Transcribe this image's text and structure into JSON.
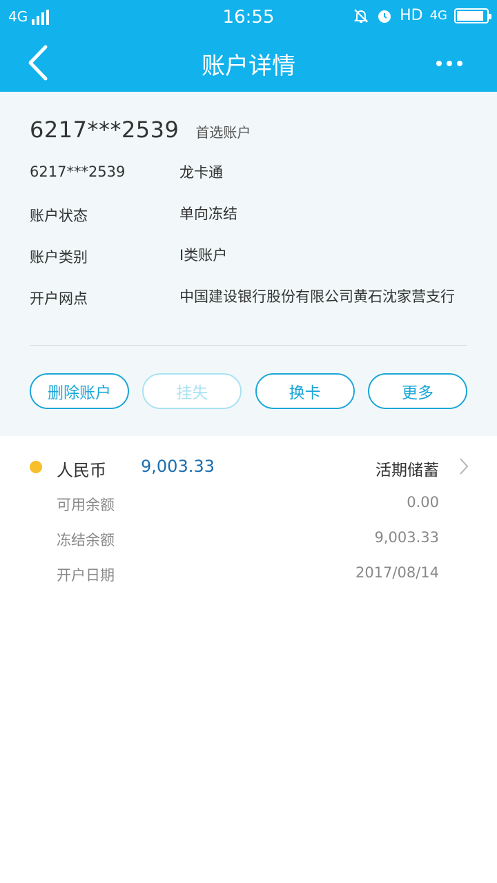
{
  "status_bar": {
    "network": "4G",
    "time": "16:55",
    "hd": "HD",
    "lte": "4G",
    "battery_level": 0.9
  },
  "navbar": {
    "title": "账户详情"
  },
  "account": {
    "number": "6217***2539",
    "tag": "首选账户",
    "details": [
      {
        "key": "6217***2539",
        "value": "龙卡通"
      },
      {
        "key": "账户状态",
        "value": "单向冻结"
      },
      {
        "key": "账户类别",
        "value": "I类账户"
      },
      {
        "key": "开户网点",
        "value": "中国建设银行股份有限公司黄石沈家营支行"
      }
    ],
    "buttons": {
      "delete": "删除账户",
      "report_loss": "挂失",
      "replace_card": "换卡",
      "more": "更多"
    }
  },
  "balance": {
    "currency": "人民币",
    "amount": "9,003.33",
    "type": "活期储蓄",
    "rows": [
      {
        "label": "可用余额",
        "value": "0.00"
      },
      {
        "label": "冻结余额",
        "value": "9,003.33"
      },
      {
        "label": "开户日期",
        "value": "2017/08/14"
      }
    ]
  },
  "colors": {
    "primary": "#12b2ec",
    "button": "#1aa6d8",
    "amount": "#1a6eae",
    "dot": "#f7bf2a"
  }
}
